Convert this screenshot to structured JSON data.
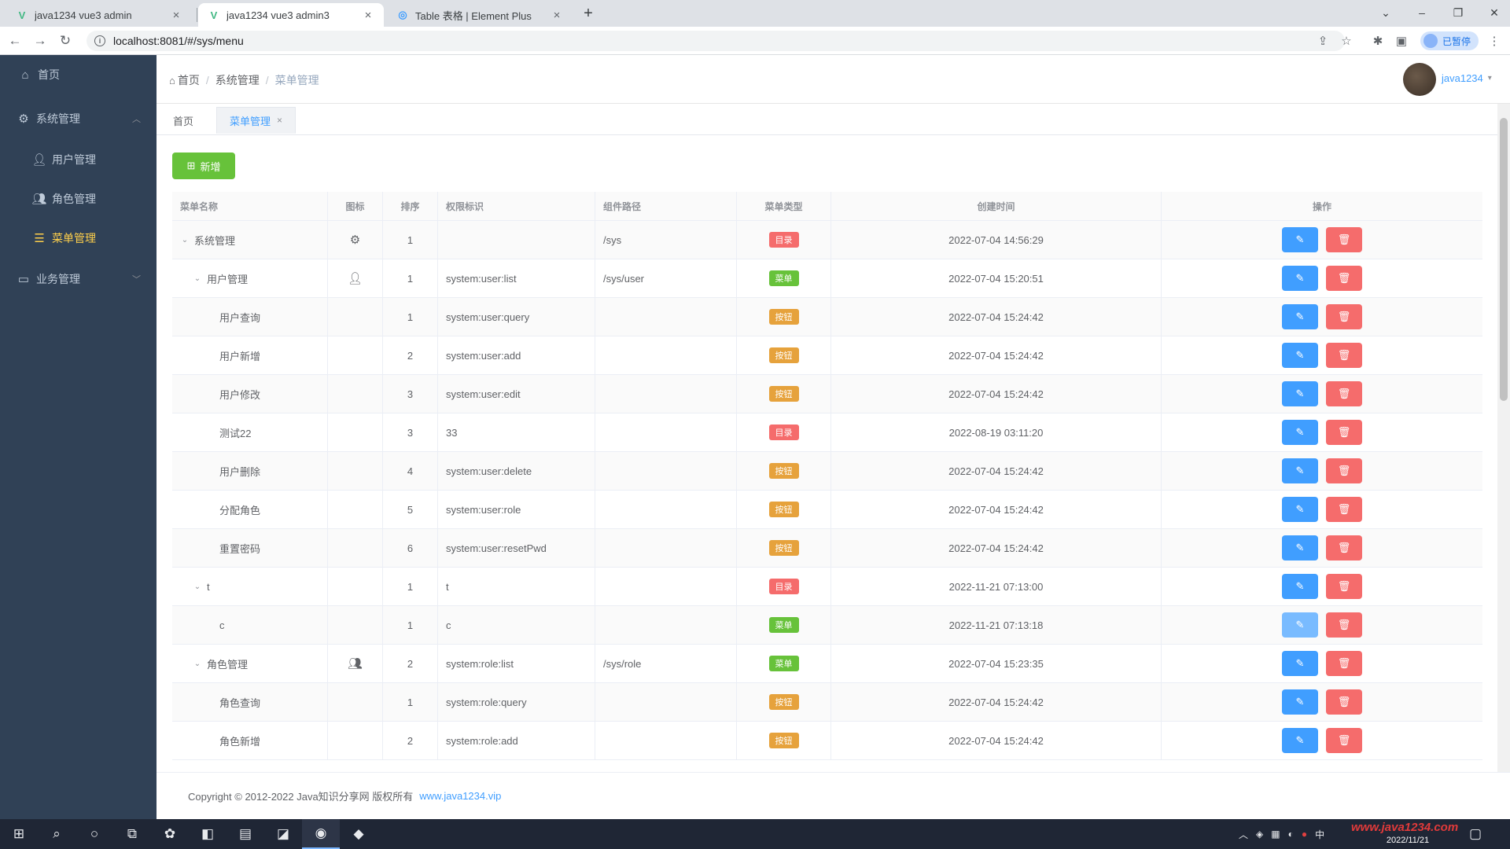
{
  "browser": {
    "tabs": [
      {
        "title": "java1234 vue3 admin",
        "favicon": "vue-icon"
      },
      {
        "title": "java1234 vue3 admin3",
        "favicon": "vue-icon"
      },
      {
        "title": "Table 表格 | Element Plus",
        "favicon": "element-plus-icon"
      }
    ],
    "url": "localhost:8081/#/sys/menu",
    "profile_label": "已暂停"
  },
  "sidebar": {
    "items": [
      {
        "label": "首页",
        "icon": "home-icon"
      },
      {
        "label": "系统管理",
        "icon": "gear-icon"
      },
      {
        "label": "用户管理",
        "icon": "user-icon"
      },
      {
        "label": "角色管理",
        "icon": "users-icon"
      },
      {
        "label": "菜单管理",
        "icon": "tree-table-icon"
      },
      {
        "label": "业务管理",
        "icon": "monitor-icon"
      }
    ]
  },
  "header": {
    "breadcrumb": [
      "首页",
      "系统管理",
      "菜单管理"
    ],
    "username": "java1234"
  },
  "tagsview": {
    "tabs": [
      "首页",
      "菜单管理"
    ]
  },
  "toolbar": {
    "add_label": "新增"
  },
  "table": {
    "columns": [
      "菜单名称",
      "图标",
      "排序",
      "权限标识",
      "组件路径",
      "菜单类型",
      "创建时间",
      "操作"
    ],
    "rows": [
      {
        "name": "系统管理",
        "icon": "gear-icon",
        "order": "1",
        "perms": "",
        "path": "/sys",
        "type": "目录",
        "kind": "dir",
        "time": "2022-07-04 14:56:29"
      },
      {
        "name": "用户管理",
        "icon": "user-icon",
        "order": "1",
        "perms": "system:user:list",
        "path": "/sys/user",
        "type": "菜单",
        "kind": "menu",
        "time": "2022-07-04 15:20:51"
      },
      {
        "name": "用户查询",
        "icon": "",
        "order": "1",
        "perms": "system:user:query",
        "path": "",
        "type": "按钮",
        "kind": "btn",
        "time": "2022-07-04 15:24:42"
      },
      {
        "name": "用户新增",
        "icon": "",
        "order": "2",
        "perms": "system:user:add",
        "path": "",
        "type": "按钮",
        "kind": "btn",
        "time": "2022-07-04 15:24:42"
      },
      {
        "name": "用户修改",
        "icon": "",
        "order": "3",
        "perms": "system:user:edit",
        "path": "",
        "type": "按钮",
        "kind": "btn",
        "time": "2022-07-04 15:24:42"
      },
      {
        "name": "测试22",
        "icon": "",
        "order": "3",
        "perms": "33",
        "path": "",
        "type": "目录",
        "kind": "dir",
        "time": "2022-08-19 03:11:20"
      },
      {
        "name": "用户删除",
        "icon": "",
        "order": "4",
        "perms": "system:user:delete",
        "path": "",
        "type": "按钮",
        "kind": "btn",
        "time": "2022-07-04 15:24:42"
      },
      {
        "name": "分配角色",
        "icon": "",
        "order": "5",
        "perms": "system:user:role",
        "path": "",
        "type": "按钮",
        "kind": "btn",
        "time": "2022-07-04 15:24:42"
      },
      {
        "name": "重置密码",
        "icon": "",
        "order": "6",
        "perms": "system:user:resetPwd",
        "path": "",
        "type": "按钮",
        "kind": "btn",
        "time": "2022-07-04 15:24:42"
      },
      {
        "name": "t",
        "icon": "",
        "order": "1",
        "perms": "t",
        "path": "",
        "type": "目录",
        "kind": "dir",
        "time": "2022-11-21 07:13:00"
      },
      {
        "name": "c",
        "icon": "",
        "order": "1",
        "perms": "c",
        "path": "",
        "type": "菜单",
        "kind": "menu",
        "time": "2022-11-21 07:13:18"
      },
      {
        "name": "角色管理",
        "icon": "users-icon",
        "order": "2",
        "perms": "system:role:list",
        "path": "/sys/role",
        "type": "菜单",
        "kind": "menu",
        "time": "2022-07-04 15:23:35"
      },
      {
        "name": "角色查询",
        "icon": "",
        "order": "1",
        "perms": "system:role:query",
        "path": "",
        "type": "按钮",
        "kind": "btn",
        "time": "2022-07-04 15:24:42"
      },
      {
        "name": "角色新增",
        "icon": "",
        "order": "2",
        "perms": "system:role:add",
        "path": "",
        "type": "按钮",
        "kind": "btn",
        "time": "2022-07-04 15:24:42"
      }
    ]
  },
  "footer": {
    "copyright": "Copyright © 2012-2022 Java知识分享网 版权所有",
    "link": "www.java1234.vip"
  },
  "taskbar": {
    "date": "2022/11/21",
    "ime": "中",
    "watermark": "www.java1234.com"
  },
  "colors": {
    "sidebar_bg": "#304156",
    "active_menu": "#ffd04b",
    "primary": "#409eff",
    "success": "#67c23a",
    "danger": "#f56c6c",
    "warning": "#e6a23c"
  }
}
